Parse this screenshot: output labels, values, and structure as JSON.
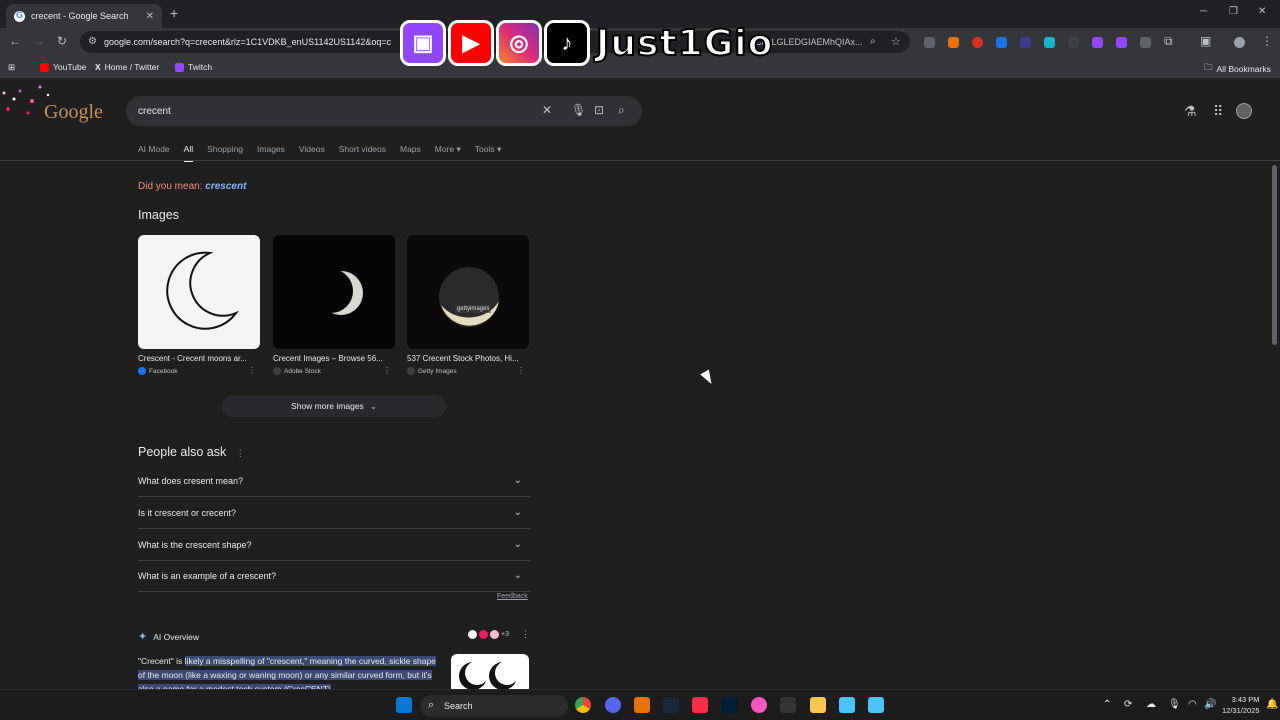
{
  "browser": {
    "tab_title": "crecent - Google Search",
    "new_tab_label": "+",
    "url": "google.com/search?q=crecent&rlz=1C1VDKB_enUS1142US1142&oq=c",
    "url_tail": "ChgLGLEDGIAEMhQIAx...",
    "bookmarks": [
      "YouTube",
      "Home / Twitter",
      "Twitch"
    ],
    "all_bookmarks": "All Bookmarks"
  },
  "overlay": {
    "handle": "Just1Gio"
  },
  "google": {
    "logo": "Google",
    "query": "crecent",
    "tabs": [
      "AI Mode",
      "All",
      "Shopping",
      "Images",
      "Videos",
      "Short videos",
      "Maps",
      "More ▾",
      "Tools ▾"
    ],
    "did_you_mean_prefix": "Did you mean: ",
    "did_you_mean_term": "crescent",
    "images_heading": "Images",
    "images": [
      {
        "caption": "Crescent - Crecent moons ar...",
        "source": "Facebook",
        "source_color": "#1877f2"
      },
      {
        "caption": "Crecent Images – Browse 56...",
        "source": "Adobe Stock",
        "source_color": "#3c4043"
      },
      {
        "caption": "537 Crecent Stock Photos, Hi...",
        "source": "Getty Images",
        "source_color": "#3c4043"
      }
    ],
    "getty_watermark": "gettyimages",
    "show_more": "Show more images",
    "paa_heading": "People also ask",
    "questions": [
      "What does cresent mean?",
      "Is it crescent or crecent?",
      "What is the crescent shape?",
      "What is an example of a crescent?"
    ],
    "feedback": "Feedback",
    "ai_overview_label": "AI Overview",
    "ai_more_count": "+3",
    "ai_text_start": "\"Crecent\" is ",
    "ai_text_highlight": "likely a misspelling of \"crescent,\" meaning the curved, sickle shape of the moon (like a waxing or waning moon) or any similar curved form, but it's also a name for a modest tech system (CresCENT)"
  },
  "taskbar": {
    "search_label": "Search",
    "time": "3:43 PM",
    "date": "12/31/2025"
  }
}
